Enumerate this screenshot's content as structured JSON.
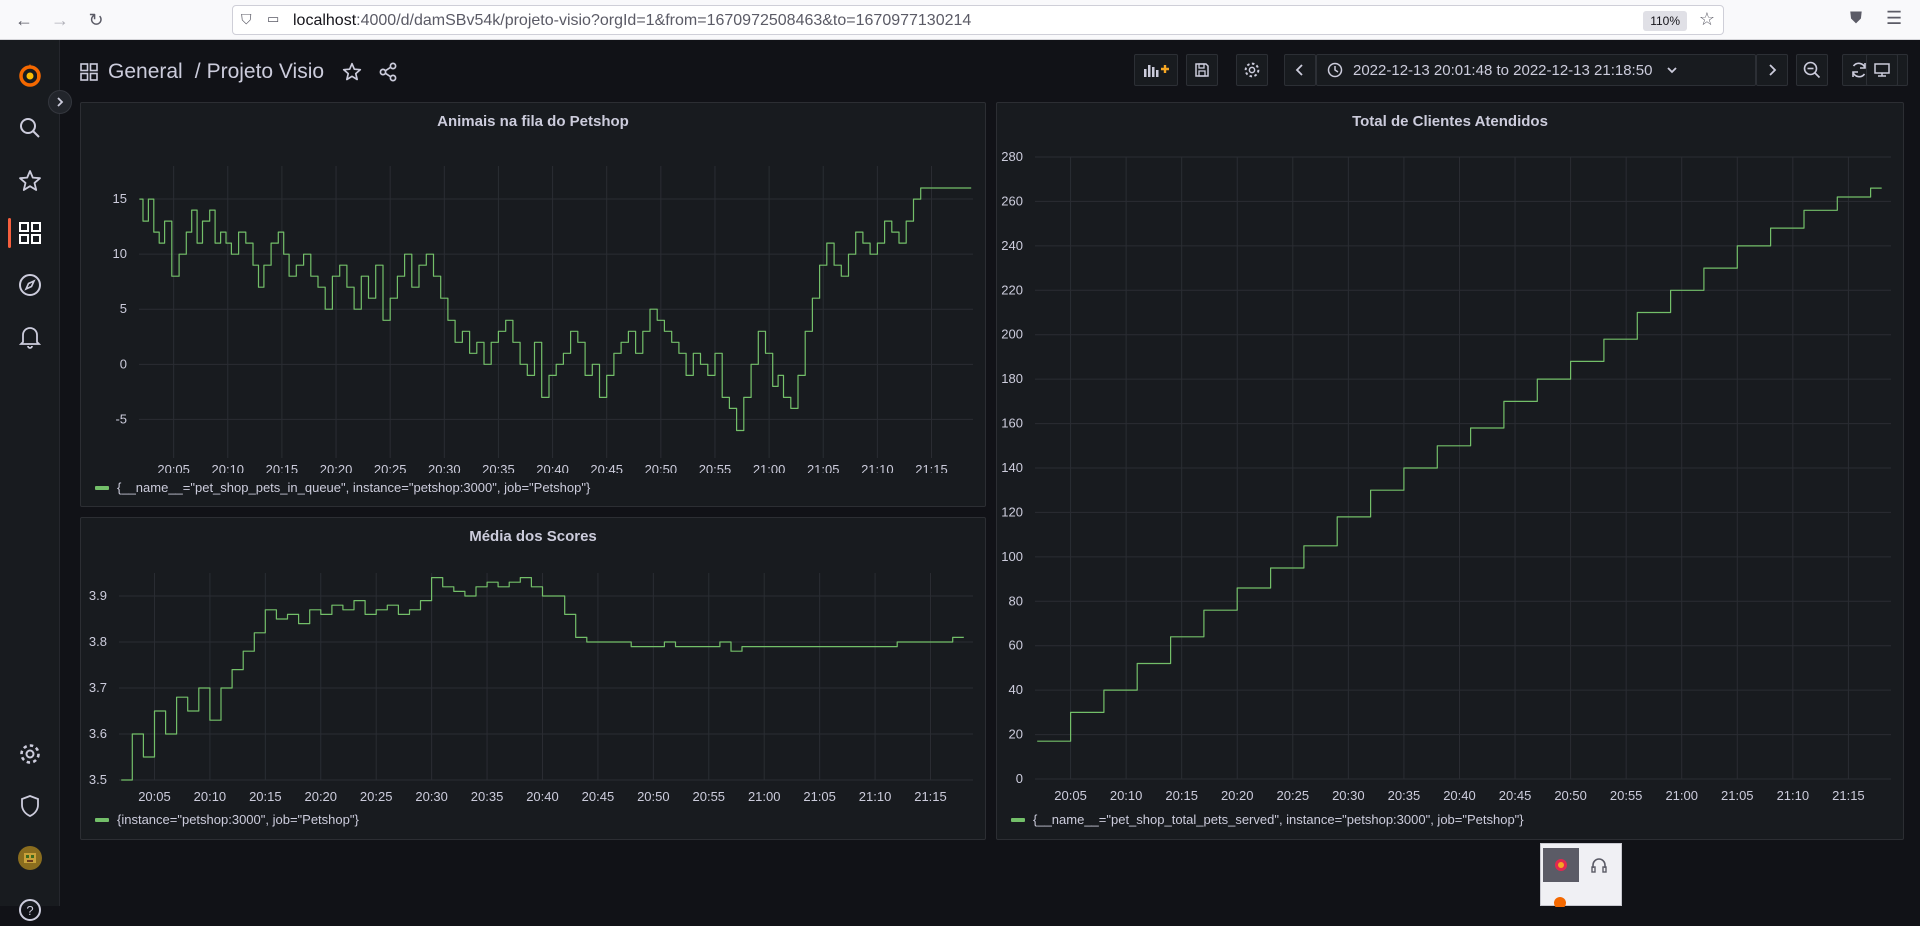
{
  "browser": {
    "url_host": "localhost",
    "url_rest": ":4000/d/damSBv54k/projeto-visio?orgId=1&from=1670972508463&to=1670977130214",
    "zoom": "110%"
  },
  "breadcrumb": {
    "folder": "General",
    "separator": "/",
    "dashboard": "Projeto Visio"
  },
  "timepicker": {
    "range": "2022-12-13 20:01:48 to 2022-12-13 21:18:50"
  },
  "colors": {
    "series": "#73bf69",
    "grid": "#2a2d33",
    "accent": "#f55f3e"
  },
  "icons": {
    "sidebar": [
      "grafana-logo-icon",
      "search-icon",
      "star-icon",
      "dashboards-icon",
      "explore-icon",
      "alerting-icon",
      "configuration-icon",
      "shield-icon",
      "avatar",
      "help-icon"
    ]
  },
  "chart_data": [
    {
      "type": "line",
      "title": "Animais na fila do Petshop",
      "x_ticks": [
        "20:05",
        "20:10",
        "20:15",
        "20:20",
        "20:25",
        "20:30",
        "20:35",
        "20:40",
        "20:45",
        "20:50",
        "20:55",
        "21:00",
        "21:05",
        "21:10",
        "21:15"
      ],
      "y_ticks": [
        "15",
        "10",
        "5",
        "0",
        "-5"
      ],
      "x_range": [
        "20:01:48",
        "21:18:50"
      ],
      "ylim": [
        -8.5,
        18
      ],
      "grid": true,
      "legend": "bottom-left",
      "series": [
        {
          "name": "{__name__=\"pet_shop_pets_in_queue\", instance=\"petshop:3000\", job=\"Petshop\"}",
          "x": [
            "20:01:50",
            "20:02:10",
            "20:02:40",
            "20:03:10",
            "20:03:40",
            "20:04:10",
            "20:04:50",
            "20:05:30",
            "20:06:10",
            "20:06:40",
            "20:07:10",
            "20:07:40",
            "20:08:20",
            "20:08:50",
            "20:09:20",
            "20:09:50",
            "20:10:20",
            "20:11:00",
            "20:11:40",
            "20:12:20",
            "20:12:50",
            "20:13:20",
            "20:14:00",
            "20:14:40",
            "20:15:10",
            "20:15:40",
            "20:16:20",
            "20:17:00",
            "20:17:40",
            "20:18:20",
            "20:19:00",
            "20:19:40",
            "20:20:20",
            "20:21:00",
            "20:21:40",
            "20:22:20",
            "20:23:00",
            "20:23:40",
            "20:24:20",
            "20:25:00",
            "20:25:40",
            "20:26:20",
            "20:27:00",
            "20:27:40",
            "20:28:20",
            "20:29:00",
            "20:29:40",
            "20:30:20",
            "20:31:00",
            "20:31:40",
            "20:32:20",
            "20:33:00",
            "20:33:40",
            "20:34:20",
            "20:35:00",
            "20:35:40",
            "20:36:20",
            "20:37:00",
            "20:37:40",
            "20:38:20",
            "20:39:00",
            "20:39:40",
            "20:40:20",
            "20:41:00",
            "20:41:40",
            "20:42:20",
            "20:43:00",
            "20:43:40",
            "20:44:20",
            "20:45:00",
            "20:45:40",
            "20:46:20",
            "20:47:00",
            "20:47:40",
            "20:48:20",
            "20:49:00",
            "20:49:40",
            "20:50:20",
            "20:51:00",
            "20:51:40",
            "20:52:20",
            "20:53:00",
            "20:53:40",
            "20:54:20",
            "20:55:00",
            "20:55:40",
            "20:56:20",
            "20:57:00",
            "20:57:40",
            "20:58:20",
            "20:59:00",
            "20:59:40",
            "21:00:20",
            "21:00:50",
            "21:01:20",
            "21:02:00",
            "21:02:40",
            "21:03:20",
            "21:04:00",
            "21:04:40",
            "21:05:20",
            "21:06:00",
            "21:06:40",
            "21:07:20",
            "21:08:00",
            "21:08:40",
            "21:09:20",
            "21:10:00",
            "21:10:40",
            "21:11:20",
            "21:12:00",
            "21:12:40",
            "21:13:20",
            "21:14:00",
            "21:14:40",
            "21:15:20",
            "21:16:00",
            "21:16:40",
            "21:17:20",
            "21:18:00",
            "21:18:40"
          ],
          "values": [
            15,
            13,
            15,
            12,
            11,
            13,
            8,
            10,
            12,
            14,
            11,
            13,
            14,
            11,
            12,
            11,
            10,
            12,
            11,
            9,
            7,
            9,
            11,
            12,
            10,
            8,
            9,
            10,
            8,
            7,
            5,
            8,
            9,
            7,
            5,
            8,
            6,
            9,
            4,
            6,
            8,
            10,
            7,
            9,
            10,
            8,
            6,
            4,
            2,
            3,
            1,
            2,
            0,
            2,
            3,
            4,
            2,
            0,
            -1,
            2,
            -3,
            -1,
            0,
            1,
            3,
            2,
            -1,
            0,
            -3,
            -1,
            1,
            2,
            3,
            1,
            3,
            5,
            4,
            3,
            2,
            1,
            -1,
            1,
            0,
            -1,
            1,
            -3,
            -4,
            -6,
            -3,
            0,
            3,
            1,
            -2,
            -1,
            -3,
            -4,
            -1,
            3,
            6,
            9,
            11,
            9,
            8,
            10,
            12,
            11,
            10,
            11,
            13,
            12,
            11,
            13,
            15,
            16,
            16,
            16,
            16,
            16,
            16,
            16,
            16
          ],
          "unit": "count"
        }
      ]
    },
    {
      "type": "line",
      "title": "Média dos Scores",
      "x_ticks": [
        "20:05",
        "20:10",
        "20:15",
        "20:20",
        "20:25",
        "20:30",
        "20:35",
        "20:40",
        "20:45",
        "20:50",
        "20:55",
        "21:00",
        "21:05",
        "21:10",
        "21:15"
      ],
      "y_ticks": [
        "3.9",
        "3.8",
        "3.7",
        "3.6",
        "3.5"
      ],
      "x_range": [
        "20:01:48",
        "21:18:50"
      ],
      "ylim": [
        3.5,
        3.95
      ],
      "grid": true,
      "legend": "bottom-left",
      "series": [
        {
          "name": "{instance=\"petshop:3000\", job=\"Petshop\"}",
          "x": [
            "20:02",
            "20:03",
            "20:04",
            "20:05",
            "20:06",
            "20:07",
            "20:08",
            "20:09",
            "20:10",
            "20:11",
            "20:12",
            "20:13",
            "20:14",
            "20:15",
            "20:16",
            "20:17",
            "20:18",
            "20:19",
            "20:20",
            "20:21",
            "20:22",
            "20:23",
            "20:24",
            "20:25",
            "20:26",
            "20:27",
            "20:28",
            "20:29",
            "20:30",
            "20:31",
            "20:32",
            "20:33",
            "20:34",
            "20:35",
            "20:36",
            "20:37",
            "20:38",
            "20:39",
            "20:40",
            "20:41",
            "20:42",
            "20:43",
            "20:44",
            "20:45",
            "20:46",
            "20:47",
            "20:48",
            "20:49",
            "20:50",
            "20:51",
            "20:52",
            "20:53",
            "20:54",
            "20:55",
            "20:56",
            "20:57",
            "20:58",
            "20:59",
            "21:00",
            "21:01",
            "21:02",
            "21:03",
            "21:04",
            "21:05",
            "21:06",
            "21:07",
            "21:08",
            "21:09",
            "21:10",
            "21:11",
            "21:12",
            "21:13",
            "21:14",
            "21:15",
            "21:16",
            "21:17",
            "21:18"
          ],
          "values": [
            3.5,
            3.6,
            3.55,
            3.65,
            3.6,
            3.68,
            3.65,
            3.7,
            3.63,
            3.7,
            3.74,
            3.78,
            3.82,
            3.87,
            3.85,
            3.86,
            3.84,
            3.87,
            3.86,
            3.88,
            3.87,
            3.89,
            3.86,
            3.87,
            3.88,
            3.86,
            3.87,
            3.89,
            3.94,
            3.92,
            3.91,
            3.9,
            3.92,
            3.93,
            3.92,
            3.93,
            3.94,
            3.92,
            3.9,
            3.9,
            3.86,
            3.81,
            3.8,
            3.8,
            3.8,
            3.8,
            3.79,
            3.79,
            3.79,
            3.8,
            3.79,
            3.79,
            3.79,
            3.79,
            3.8,
            3.78,
            3.79,
            3.79,
            3.79,
            3.79,
            3.79,
            3.79,
            3.79,
            3.79,
            3.79,
            3.79,
            3.79,
            3.79,
            3.79,
            3.79,
            3.8,
            3.8,
            3.8,
            3.8,
            3.8,
            3.81,
            3.81
          ]
        }
      ]
    },
    {
      "type": "line",
      "title": "Total de Clientes Atendidos",
      "x_ticks": [
        "20:05",
        "20:10",
        "20:15",
        "20:20",
        "20:25",
        "20:30",
        "20:35",
        "20:40",
        "20:45",
        "20:50",
        "20:55",
        "21:00",
        "21:05",
        "21:10",
        "21:15"
      ],
      "y_ticks": [
        "280",
        "260",
        "240",
        "220",
        "200",
        "180",
        "160",
        "140",
        "120",
        "100",
        "80",
        "60",
        "40",
        "20",
        "0"
      ],
      "x_range": [
        "20:01:48",
        "21:18:50"
      ],
      "ylim": [
        0,
        280
      ],
      "grid": true,
      "legend": "bottom-left",
      "series": [
        {
          "name": "{__name__=\"pet_shop_total_pets_served\", instance=\"petshop:3000\", job=\"Petshop\"}",
          "x": [
            "20:02",
            "20:05",
            "20:08",
            "20:11",
            "20:14",
            "20:17",
            "20:20",
            "20:23",
            "20:26",
            "20:29",
            "20:32",
            "20:35",
            "20:38",
            "20:41",
            "20:44",
            "20:47",
            "20:50",
            "20:53",
            "20:56",
            "20:59",
            "21:02",
            "21:05",
            "21:08",
            "21:11",
            "21:14",
            "21:17",
            "21:18"
          ],
          "values": [
            17,
            30,
            40,
            52,
            64,
            76,
            86,
            95,
            105,
            118,
            130,
            140,
            150,
            158,
            170,
            180,
            188,
            198,
            210,
            220,
            230,
            240,
            248,
            256,
            262,
            266,
            266
          ]
        }
      ]
    }
  ]
}
